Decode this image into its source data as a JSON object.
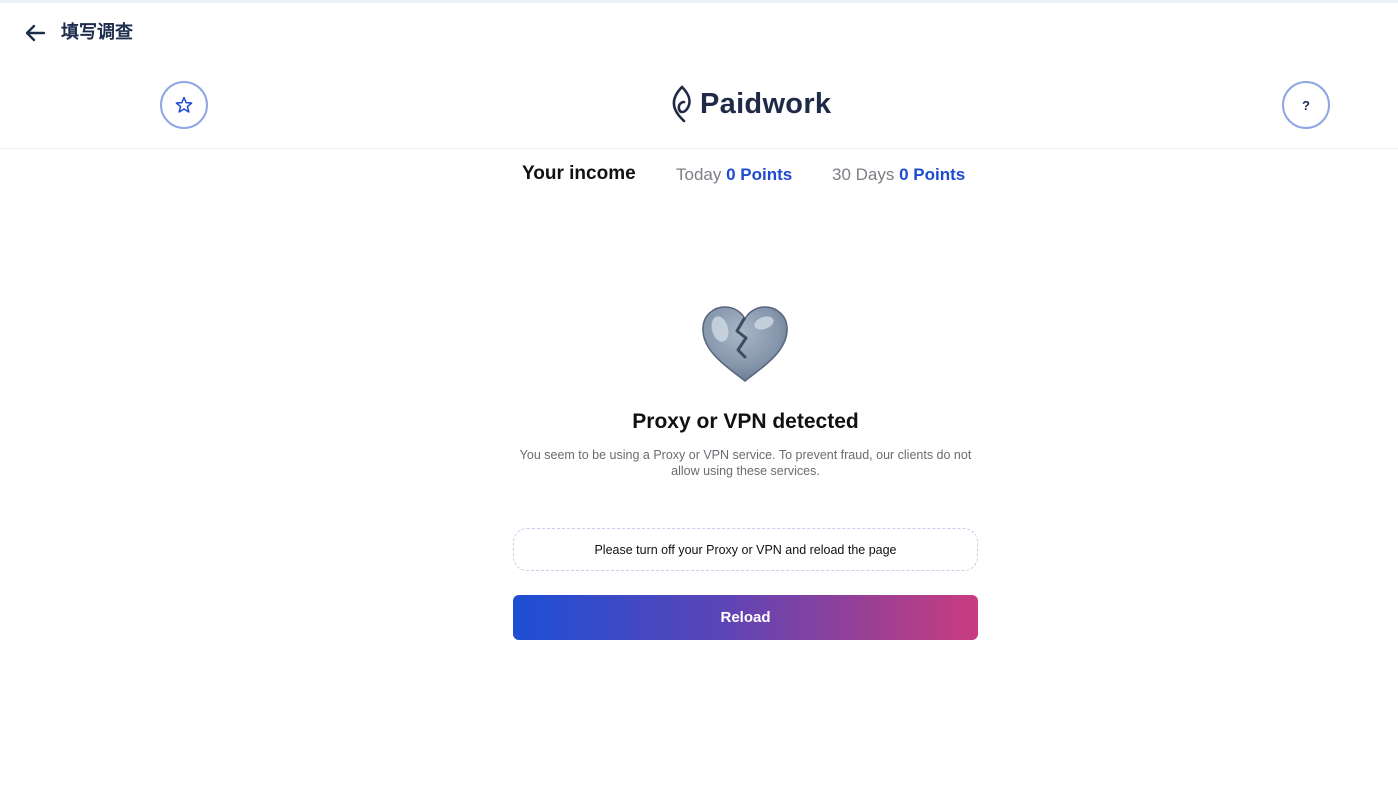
{
  "nav": {
    "back_icon": "arrow-left-icon",
    "title": "填写调查"
  },
  "header": {
    "favorite_icon": "star-icon",
    "logo_text": "Paidwork",
    "help_label": "?"
  },
  "income": {
    "label": "Your income",
    "today_label": "Today",
    "today_value": "0 Points",
    "month_label": "30 Days",
    "month_value": "0 Points"
  },
  "error": {
    "icon": "broken-heart-icon",
    "title": "Proxy or VPN detected",
    "description": "You seem to be using a Proxy or VPN service. To prevent fraud, our clients do not allow using these services.",
    "hint": "Please turn off your Proxy or VPN and reload the page",
    "reload_label": "Reload"
  },
  "colors": {
    "accent": "#1e4bd0",
    "gradient_start": "#1c4fd4",
    "gradient_end": "#c93c80",
    "circle_border": "#8fa6e4"
  }
}
